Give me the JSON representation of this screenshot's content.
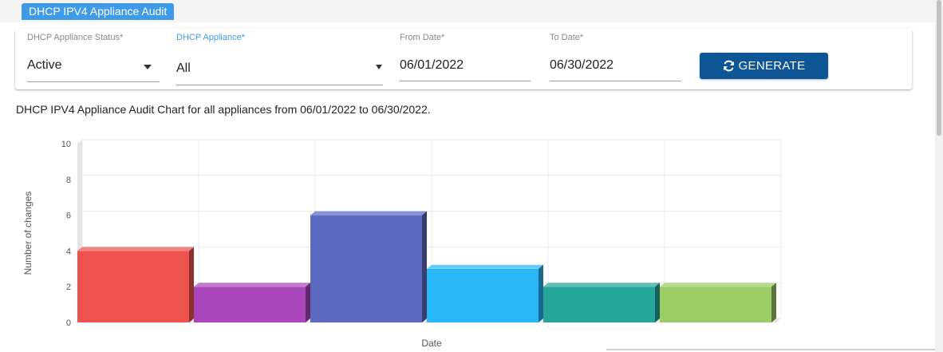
{
  "header": {
    "title": "DHCP IPV4 Appliance Audit"
  },
  "filters": {
    "status": {
      "label": "DHCP Appliance Status*",
      "value": "Active"
    },
    "appliance": {
      "label": "DHCP Appliance*",
      "value": "All"
    },
    "from_date": {
      "label": "From Date*",
      "value": "06/01/2022"
    },
    "to_date": {
      "label": "To Date*",
      "value": "06/30/2022"
    },
    "generate_label": "GENERATE"
  },
  "caption": "DHCP IPV4 Appliance Audit Chart for all appliances from 06/01/2022 to 06/30/2022.",
  "chart_data": {
    "type": "bar",
    "title": "",
    "xlabel": "Date",
    "ylabel": "Number of changes",
    "ylim": [
      0,
      10
    ],
    "yticks": [
      0,
      2,
      4,
      6,
      8,
      10
    ],
    "grid": true,
    "legend": "none",
    "style": "3d",
    "categories": [
      "",
      "",
      "",
      "",
      "",
      ""
    ],
    "values": [
      4,
      2,
      6,
      3,
      2,
      2
    ],
    "colors": [
      "#ef5350",
      "#ab47bc",
      "#5c6bc0",
      "#29b6f6",
      "#26a69a",
      "#9ccc65"
    ]
  }
}
